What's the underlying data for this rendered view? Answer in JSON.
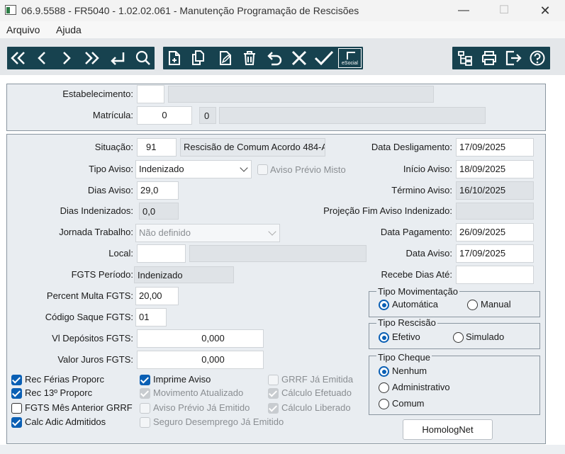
{
  "window": {
    "title": "06.9.5588 - FR5040 - 1.02.02.061 - Manutenção Programação de Rescisões",
    "minimize_glyph": "—",
    "maximize_glyph": "☐",
    "close_glyph": "✕"
  },
  "menu": {
    "items": [
      "Arquivo",
      "Ajuda"
    ]
  },
  "toolbar": {
    "nav": [
      "first-icon",
      "previous-icon",
      "next-icon",
      "last-icon",
      "enter-icon",
      "search-icon"
    ],
    "edit": [
      "new-icon",
      "copy-icon",
      "edit-icon",
      "delete-icon",
      "undo-icon",
      "cancel-icon",
      "confirm-icon"
    ],
    "esocial_label": "eSocial",
    "right": [
      "tree-icon",
      "print-icon",
      "exit-icon",
      "help-icon"
    ]
  },
  "header": {
    "estabelecimento_label": "Estabelecimento:",
    "estabelecimento_value": "",
    "estabelecimento_desc": "",
    "matricula_label": "Matrícula:",
    "matricula_value": "0",
    "matricula_digit": "0",
    "matricula_desc": ""
  },
  "left": {
    "situacao_label": "Situação:",
    "situacao_code": "91",
    "situacao_desc": "Rescisão de Comum Acordo 484-A",
    "tipo_aviso_label": "Tipo Aviso:",
    "tipo_aviso_value": "Indenizado",
    "aviso_previo_misto_label": "Aviso Prévio Misto",
    "dias_aviso_label": "Dias Aviso:",
    "dias_aviso_value": "29,0",
    "dias_indenizados_label": "Dias Indenizados:",
    "dias_indenizados_value": "0,0",
    "jornada_label": "Jornada Trabalho:",
    "jornada_value": "Não definido",
    "local_label": "Local:",
    "local_value": "",
    "local_desc": "",
    "fgts_periodo_label": "FGTS Período:",
    "fgts_periodo_value": "Indenizado",
    "percent_multa_label": "Percent Multa FGTS:",
    "percent_multa_value": "20,00",
    "codigo_saque_label": "Código Saque FGTS:",
    "codigo_saque_value": "01",
    "vl_depositos_label": "Vl Depósitos FGTS:",
    "vl_depositos_value": "0,000",
    "valor_juros_label": "Valor Juros FGTS:",
    "valor_juros_value": "0,000"
  },
  "right": {
    "data_desligamento_label": "Data Desligamento:",
    "data_desligamento_value": "17/09/2025",
    "inicio_aviso_label": "Início Aviso:",
    "inicio_aviso_value": "18/09/2025",
    "termino_aviso_label": "Término Aviso:",
    "termino_aviso_value": "16/10/2025",
    "projecao_label": "Projeção Fim Aviso Indenizado:",
    "projecao_value": "",
    "data_pagamento_label": "Data Pagamento:",
    "data_pagamento_value": "26/09/2025",
    "data_aviso_label": "Data Aviso:",
    "data_aviso_value": "17/09/2025",
    "recebe_dias_label": "Recebe Dias Até:",
    "recebe_dias_value": ""
  },
  "tipo_movimentacao": {
    "title": "Tipo Movimentação",
    "options": [
      "Automática",
      "Manual"
    ],
    "selected": "Automática"
  },
  "tipo_rescisao": {
    "title": "Tipo Rescisão",
    "options": [
      "Efetivo",
      "Simulado"
    ],
    "selected": "Efetivo"
  },
  "tipo_cheque": {
    "title": "Tipo Cheque",
    "options": [
      "Nenhum",
      "Administrativo",
      "Comum"
    ],
    "selected": "Nenhum"
  },
  "checkboxes": {
    "rec_ferias": {
      "label": "Rec Férias Proporc",
      "checked": true,
      "enabled": true
    },
    "rec_13": {
      "label": "Rec 13º Proporc",
      "checked": true,
      "enabled": true
    },
    "fgts_mes_anterior": {
      "label": "FGTS Mês Anterior GRRF",
      "checked": false,
      "enabled": true
    },
    "calc_adic": {
      "label": "Calc Adic Admitidos",
      "checked": true,
      "enabled": true
    },
    "imprime_aviso": {
      "label": "Imprime Aviso",
      "checked": true,
      "enabled": true
    },
    "movimento_atualizado": {
      "label": "Movimento Atualizado",
      "checked": true,
      "enabled": false
    },
    "aviso_previo_emitido": {
      "label": "Aviso Prévio Já Emitido",
      "checked": false,
      "enabled": false
    },
    "seguro_desemprego": {
      "label": "Seguro Desemprego Já Emitido",
      "checked": false,
      "enabled": false
    },
    "grrf_emitida": {
      "label": "GRRF Já Emitida",
      "checked": false,
      "enabled": false
    },
    "calculo_efetuado": {
      "label": "Cálculo Efetuado",
      "checked": true,
      "enabled": false
    },
    "calculo_liberado": {
      "label": "Cálculo Liberado",
      "checked": true,
      "enabled": false
    }
  },
  "homolognet_label": "HomologNet"
}
